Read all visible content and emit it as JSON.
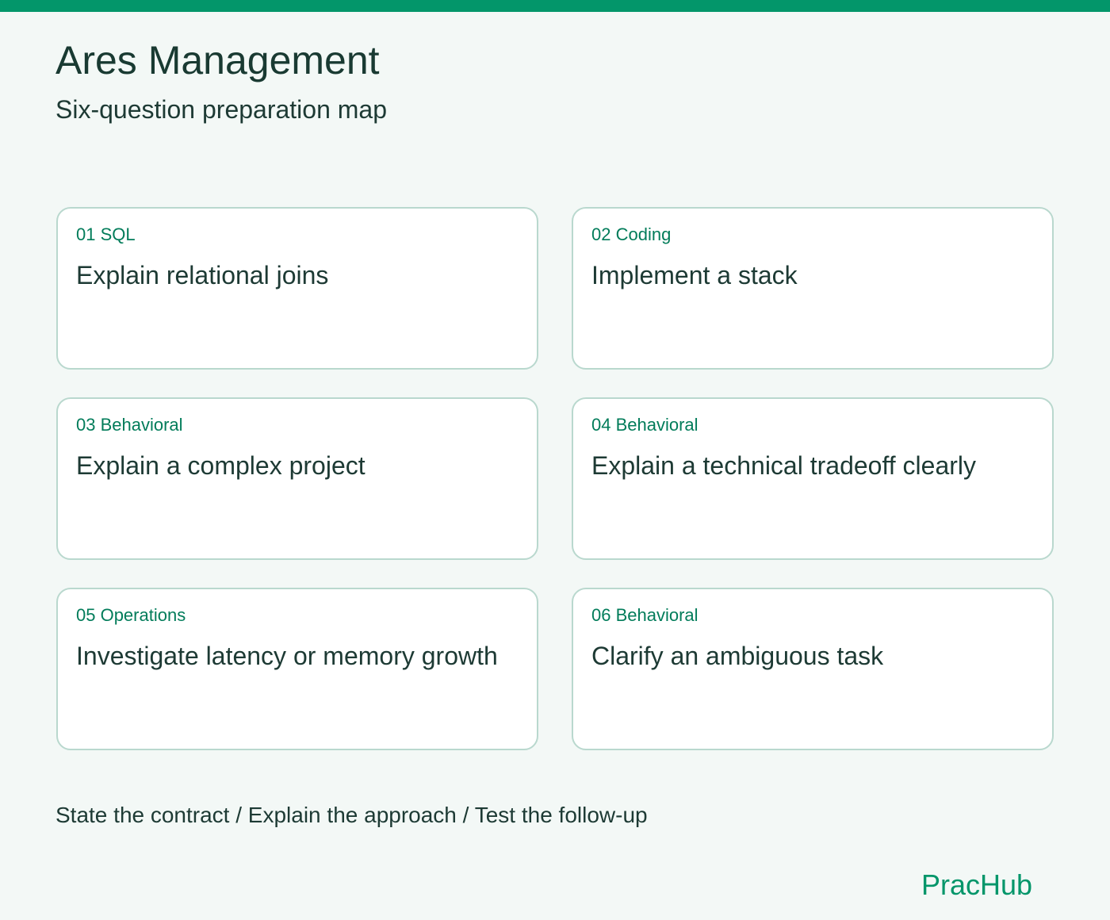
{
  "header": {
    "title": "Ares Management",
    "subtitle": "Six-question preparation map"
  },
  "cards": [
    {
      "label": "01 SQL",
      "text": "Explain relational joins"
    },
    {
      "label": "02 Coding",
      "text": "Implement a stack"
    },
    {
      "label": "03 Behavioral",
      "text": "Explain a complex project"
    },
    {
      "label": "04 Behavioral",
      "text": "Explain a technical tradeoff clearly"
    },
    {
      "label": "05 Operations",
      "text": "Investigate latency or memory growth"
    },
    {
      "label": "06 Behavioral",
      "text": "Clarify an ambiguous task"
    }
  ],
  "footer": {
    "steps": "State the contract / Explain the approach / Test the follow-up",
    "brand": "PracHub"
  },
  "colors": {
    "accent": "#03966a",
    "background": "#f3f8f6",
    "card_border": "#b9d8ce",
    "label": "#027c5a",
    "text": "#1d3a34"
  }
}
